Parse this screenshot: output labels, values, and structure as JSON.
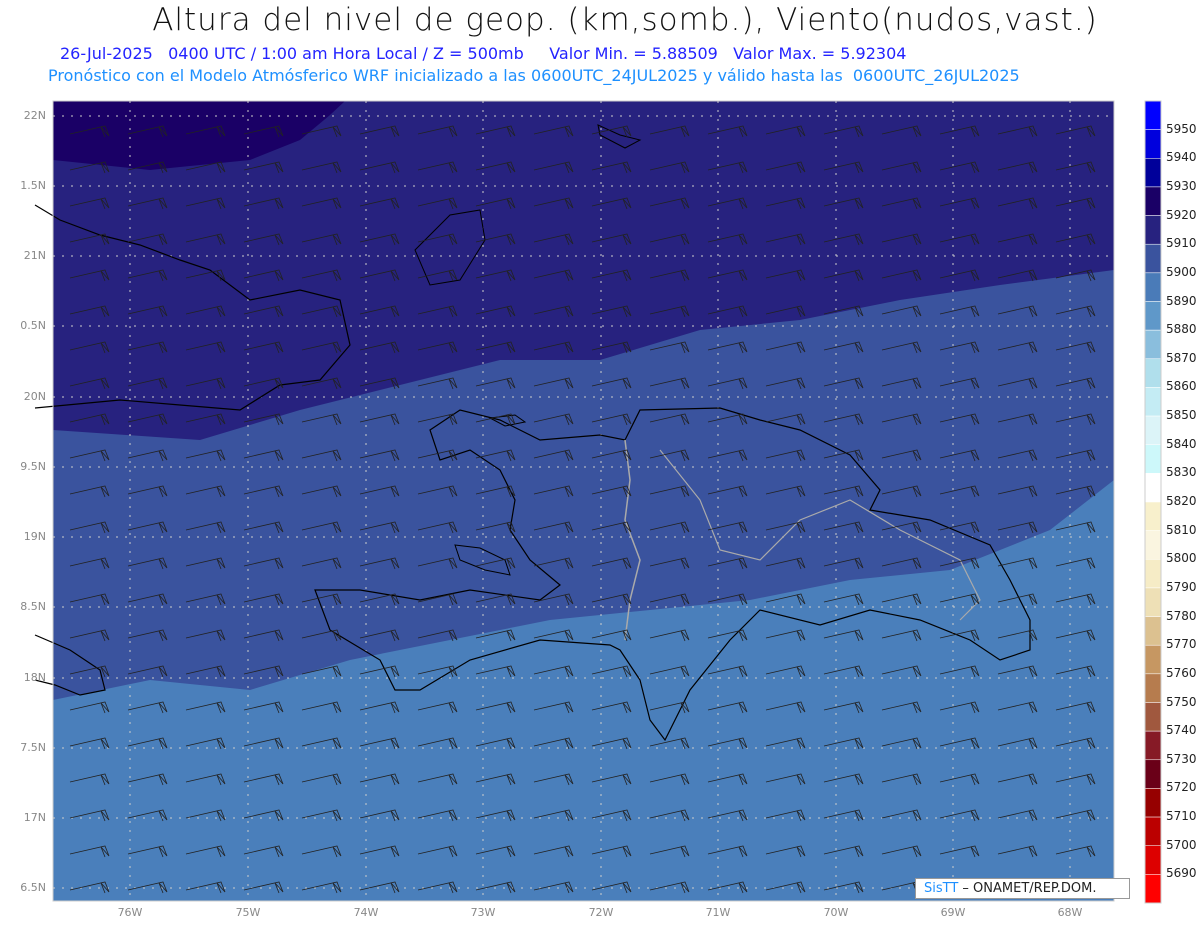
{
  "header": {
    "title": "Altura del nivel de geop. (km,somb.), Viento(nudos,vast.)",
    "subtitle": "26-Jul-2025   0400 UTC / 1:00 am Hora Local / Z = 500mb     Valor Min. = 5.88509   Valor Max. = 5.92304",
    "description": "Pronóstico con el Modelo Atmósferico WRF inicializado a las 0600UTC_24JUL2025 y válido hasta las  0600UTC_26JUL2025"
  },
  "lat_labels": [
    "22N",
    "1.5N",
    "21N",
    "0.5N",
    "20N",
    "9.5N",
    "19N",
    "8.5N",
    "18N",
    "7.5N",
    "17N",
    "6.5N"
  ],
  "lon_labels": [
    "76W",
    "75W",
    "74W",
    "73W",
    "72W",
    "71W",
    "70W",
    "69W",
    "68W"
  ],
  "colorbar": {
    "labels": [
      "5950",
      "5940",
      "5930",
      "5920",
      "5910",
      "5900",
      "5890",
      "5880",
      "5870",
      "5860",
      "5850",
      "5840",
      "5830",
      "5820",
      "5810",
      "5800",
      "5790",
      "5780",
      "5770",
      "5760",
      "5750",
      "5740",
      "5730",
      "5720",
      "5710",
      "5700",
      "5690"
    ],
    "colors": [
      "#0000ff",
      "#0000dd",
      "#00009a",
      "#1a0066",
      "#27227f",
      "#3a539e",
      "#4a7bb8",
      "#5f98c9",
      "#8abedd",
      "#b0dfec",
      "#c4ecf4",
      "#dcf4f8",
      "#cdf8fa",
      "#ffffff",
      "#f8f0cc",
      "#faf5e0",
      "#f6ecc6",
      "#eee0b6",
      "#dcc190",
      "#c69762",
      "#b67c4e",
      "#a0583e",
      "#861a26",
      "#6a0018",
      "#960000",
      "#bb0000",
      "#dd0000",
      "#ff0000"
    ]
  },
  "credit": {
    "brand": "SisTT",
    "text": " – ONAMET/REP.DOM."
  }
}
